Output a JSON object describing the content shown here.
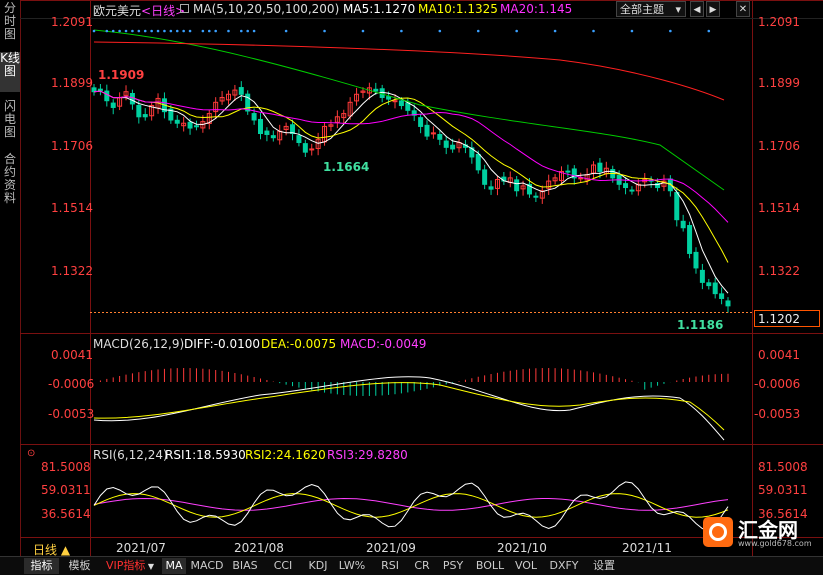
{
  "sidebar": {
    "items": [
      {
        "label": "分时图"
      },
      {
        "label": "K线图"
      },
      {
        "label": "闪电图"
      },
      {
        "label": "合约资料"
      }
    ]
  },
  "header": {
    "symbol": "欧元美元",
    "period_tag": "<日线>",
    "ma_label": "MA(5,10,20,50,100,200)",
    "ma5": "MA5:1.1270",
    "ma10": "MA10:1.1325",
    "ma20": "MA20:1.145",
    "theme_select": "全部主题",
    "nav_left": "◀",
    "nav_right": "▶",
    "close": "✕"
  },
  "price_panel": {
    "ticks": [
      "1.2091",
      "1.1899",
      "1.1706",
      "1.1514",
      "1.1322"
    ],
    "current_price": "1.1202",
    "high_label": "1.1909",
    "low_label": "1.1664",
    "last_low_label": "1.1186"
  },
  "macd_panel": {
    "title": "MACD(26,12,9)",
    "diff": "DIFF:-0.0100",
    "dea": "DEA:-0.0075",
    "macd": "MACD:-0.0049",
    "ticks": [
      "0.0041",
      "-0.0006",
      "-0.0053"
    ]
  },
  "rsi_panel": {
    "title": "RSI(6,12,24)",
    "rsi1": "RSI1:18.5930",
    "rsi2": "RSI2:24.1620",
    "rsi3": "RSI3:29.8280",
    "ticks": [
      "81.5008",
      "59.0311",
      "36.5614"
    ]
  },
  "time_axis": {
    "period_button": "日线 ▲",
    "labels": [
      "2021/07",
      "2021/08",
      "2021/09",
      "2021/10",
      "2021/11"
    ]
  },
  "bottom_tabs": [
    "指标",
    "模板",
    "VIP指标",
    "MA",
    "MACD",
    "BIAS",
    "CCI",
    "KDJ",
    "LW%",
    "RSI",
    "CR",
    "PSY",
    "BOLL",
    "VOL",
    "DXFY",
    "设置"
  ],
  "watermark": {
    "brand": "汇金网",
    "url": "www.gold678.com"
  },
  "colors": {
    "up": "#ff3a3a",
    "down": "#00d0a0",
    "ma5": "#ffffff",
    "ma10": "#ffff00",
    "ma20": "#ff00ff",
    "ma50": "#00cc00",
    "ma100": "#ff2020",
    "tick_text": "#ff4040",
    "axis_line": "#7a1010"
  },
  "chart_data": {
    "type": "candlestick",
    "price_ylim": [
      1.1186,
      1.2091
    ],
    "candles_close": [
      1.1868,
      1.1872,
      1.184,
      1.1819,
      1.185,
      1.1868,
      1.183,
      1.179,
      1.179,
      1.1825,
      1.1847,
      1.1806,
      1.178,
      1.177,
      1.177,
      1.1755,
      1.176,
      1.1775,
      1.18,
      1.1835,
      1.185,
      1.186,
      1.1873,
      1.186,
      1.1808,
      1.178,
      1.1738,
      1.1735,
      1.1725,
      1.1745,
      1.176,
      1.1738,
      1.171,
      1.168,
      1.169,
      1.172,
      1.176,
      1.1765,
      1.179,
      1.18,
      1.1835,
      1.186,
      1.187,
      1.188,
      1.187,
      1.185,
      1.1845,
      1.184,
      1.1825,
      1.181,
      1.1795,
      1.176,
      1.173,
      1.174,
      1.172,
      1.1695,
      1.169,
      1.171,
      1.1695,
      1.1665,
      1.1625,
      1.158,
      1.1565,
      1.1595,
      1.159,
      1.16,
      1.156,
      1.1575,
      1.155,
      1.154,
      1.156,
      1.159,
      1.16,
      1.162,
      1.162,
      1.16,
      1.16,
      1.161,
      1.164,
      1.162,
      1.163,
      1.16,
      1.158,
      1.157,
      1.156,
      1.158,
      1.1595,
      1.159,
      1.157,
      1.159,
      1.156,
      1.147,
      1.1445,
      1.1365,
      1.132,
      1.1275,
      1.1265,
      1.124,
      1.1225,
      1.1202
    ]
  }
}
